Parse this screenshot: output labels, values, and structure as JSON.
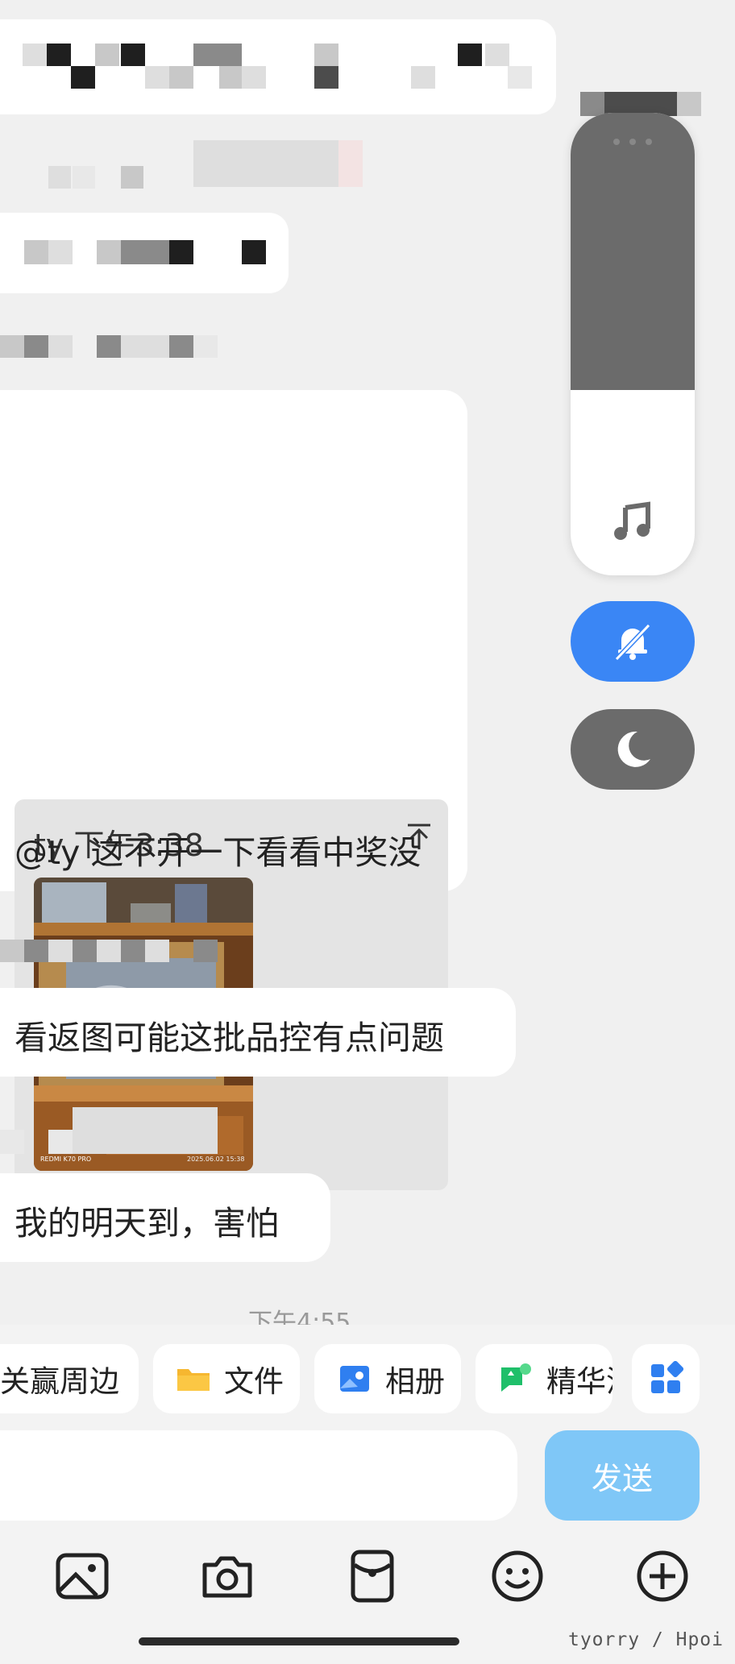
{
  "quote": {
    "author_time": "ty 下午3:38",
    "photo_caption_left": "REDMI K70 PRO",
    "photo_caption_right": "2025.06.02 15:38"
  },
  "messages": {
    "mention_text": "@ty 这不开一下看看中奖没",
    "text_2": "看返图可能这批品控有点问题",
    "text_3": "我的明天到，害怕"
  },
  "timestamp": "下午4:55",
  "quick_actions": [
    {
      "label": "关赢周边",
      "icon": "gift-icon"
    },
    {
      "label": "文件",
      "icon": "folder-icon"
    },
    {
      "label": "相册",
      "icon": "album-icon"
    },
    {
      "label": "精华消息",
      "icon": "highlight-icon"
    },
    {
      "label": "",
      "icon": "apps-grid-icon"
    }
  ],
  "input": {
    "placeholder": "",
    "send_label": "发送"
  },
  "toolbar": [
    "image-icon",
    "camera-icon",
    "red-packet-icon",
    "emoji-icon",
    "plus-icon"
  ],
  "volume_panel": {
    "level_fraction": 0.4,
    "mode_icons": [
      "music-note-icon",
      "mute-bell-icon",
      "moon-icon"
    ]
  },
  "colors": {
    "accent": "#3a86f5",
    "send_disabled": "#7fc7f7",
    "panel_dark": "#6b6b6b",
    "background": "#f0f0f0"
  },
  "watermark": "tyorry / Hpoi"
}
